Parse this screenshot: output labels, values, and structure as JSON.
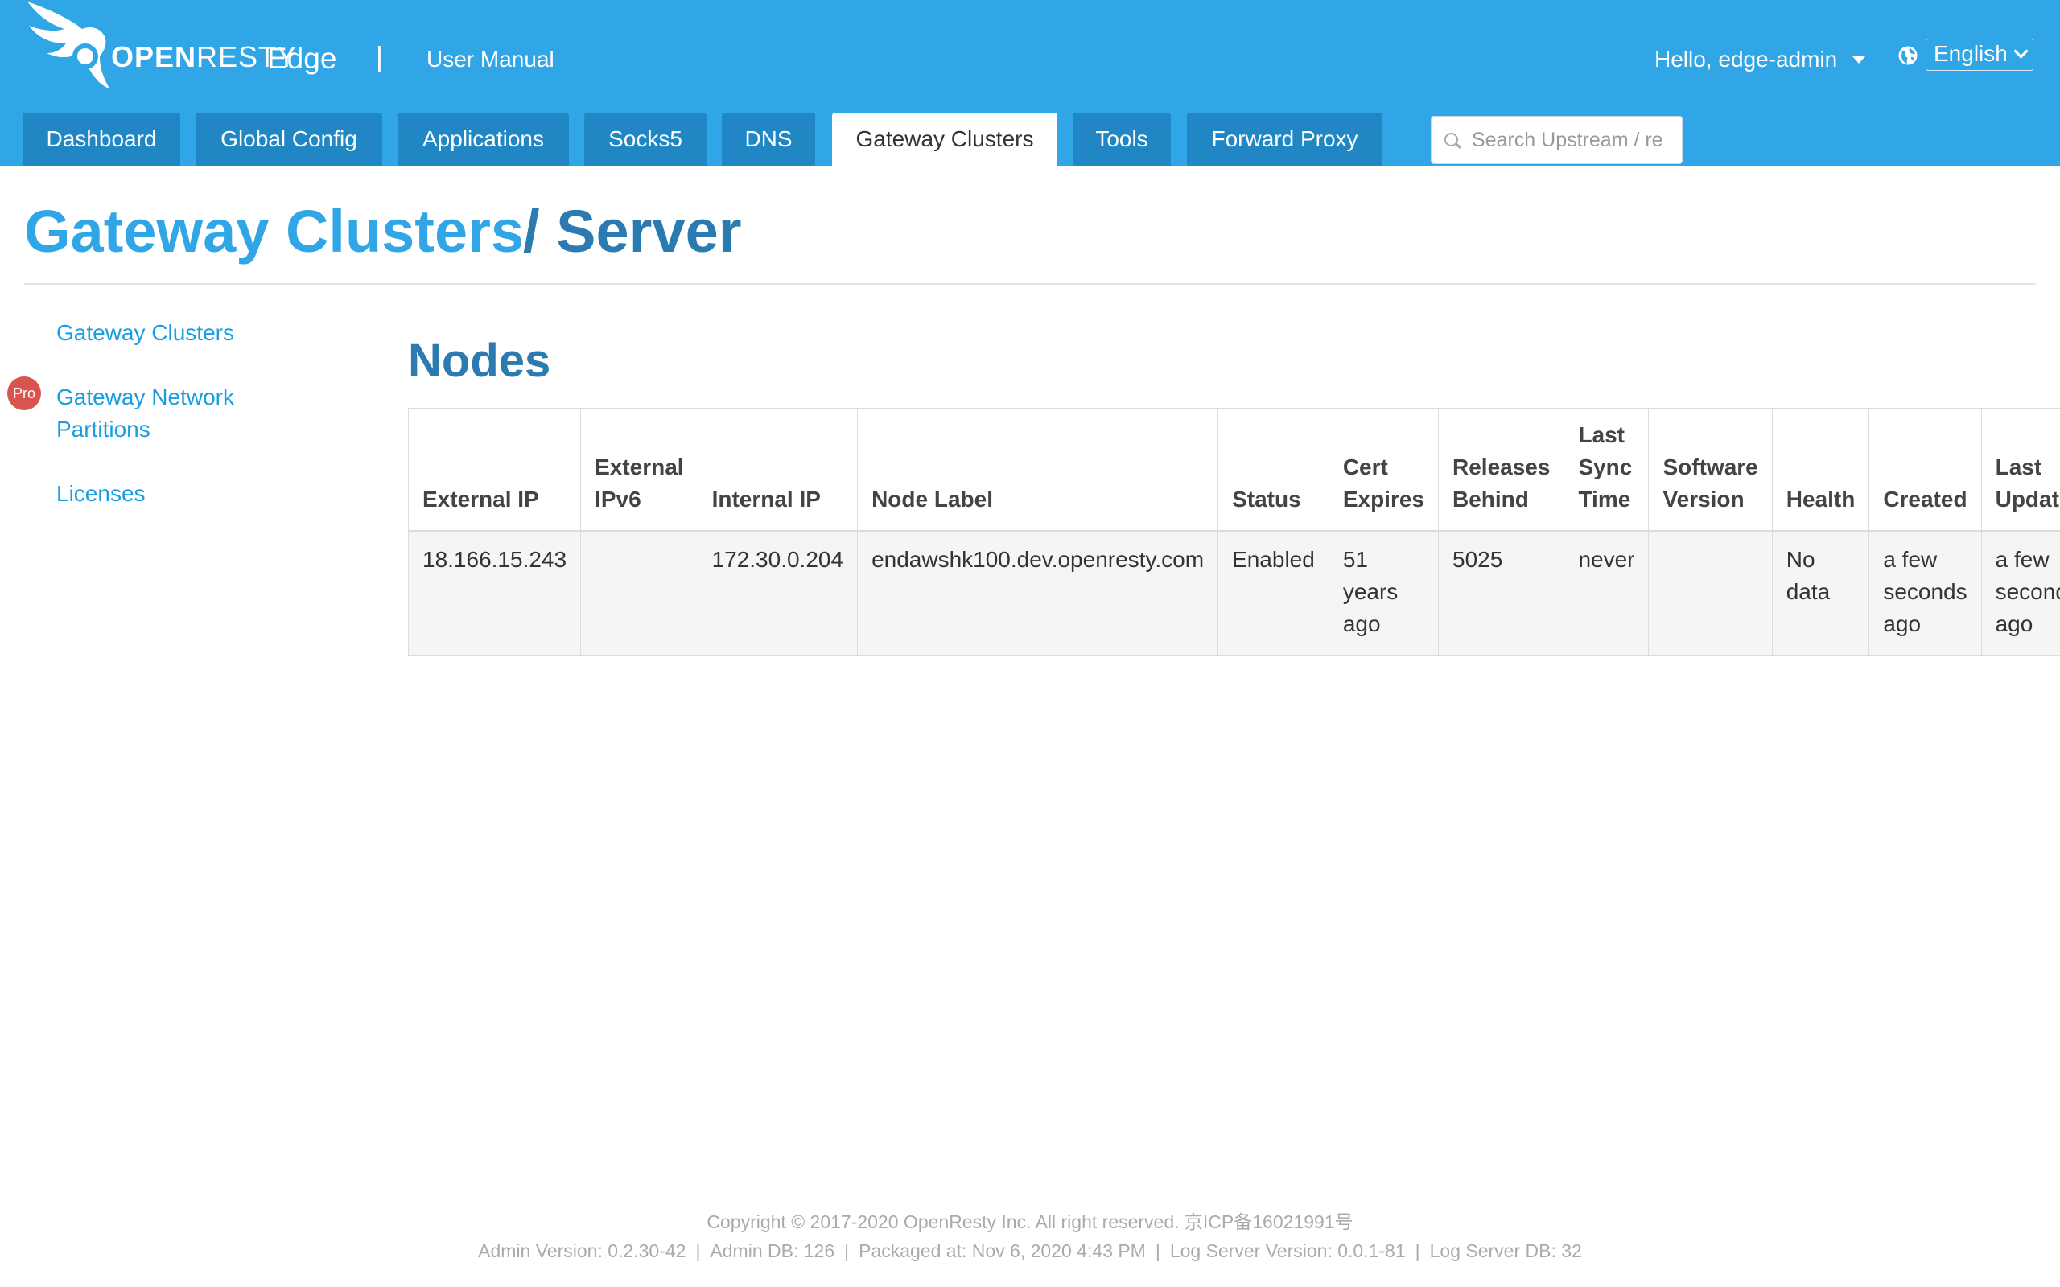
{
  "brand": {
    "logo_text_bold": "OPEN",
    "logo_text_rest": "RESTY",
    "product": "Edge",
    "separator": "|",
    "manual_link": "User Manual"
  },
  "user": {
    "greeting": "Hello, edge-admin",
    "language": "English"
  },
  "tabs": [
    {
      "label": "Dashboard",
      "active": false
    },
    {
      "label": "Global Config",
      "active": false
    },
    {
      "label": "Applications",
      "active": false
    },
    {
      "label": "Socks5",
      "active": false
    },
    {
      "label": "DNS",
      "active": false
    },
    {
      "label": "Gateway Clusters",
      "active": true
    },
    {
      "label": "Tools",
      "active": false
    },
    {
      "label": "Forward Proxy",
      "active": false
    }
  ],
  "search": {
    "placeholder": "Search Upstream / re"
  },
  "breadcrumb": {
    "parent": "Gateway Clusters",
    "current": "/ Server"
  },
  "sidebar": {
    "items": [
      {
        "label": "Gateway Clusters"
      },
      {
        "label_line1": "Gateway Network",
        "label_line2": "Partitions",
        "badge": "Pro"
      },
      {
        "label": "Licenses"
      }
    ]
  },
  "nodes": {
    "heading": "Nodes",
    "columns": [
      "External IP",
      "External IPv6",
      "Internal IP",
      "Node Label",
      "Status",
      "Cert Expires",
      "Releases Behind",
      "Last Sync Time",
      "Software Version",
      "Health",
      "Created",
      "Last Updated"
    ],
    "rows": [
      [
        "18.166.15.243",
        "",
        "172.30.0.204",
        "endawshk100.dev.openresty.com",
        "Enabled",
        "51 years ago",
        "5025",
        "never",
        "",
        "No data",
        "a few seconds ago",
        "a few seconds ago"
      ]
    ]
  },
  "footer": {
    "copyright": "Copyright © 2017-2020 OpenResty Inc. All right reserved. 京ICP备16021991号",
    "admin_version": "Admin Version: 0.2.30-42",
    "admin_db": "Admin DB: 126",
    "packaged": "Packaged at: Nov 6, 2020 4:43 PM",
    "log_server_version": "Log Server Version: 0.0.1-81",
    "log_server_db": "Log Server DB: 32",
    "separator": "|"
  },
  "colors": {
    "header_bg": "#30a6e6",
    "tab_bg": "#2186c4",
    "link": "#1a9ee0",
    "heading": "#2b7bb0",
    "pro_badge": "#d9534f"
  }
}
